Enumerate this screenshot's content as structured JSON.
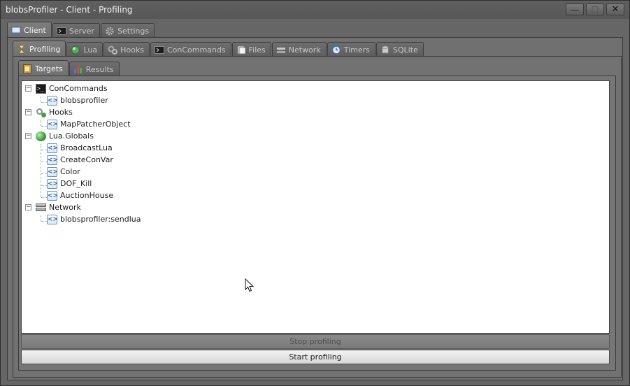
{
  "window": {
    "title": "blobsProfiler - Client - Profiling",
    "minimize_glyph": "—",
    "maximize_glyph": "☐",
    "close_glyph": "✕"
  },
  "main_tabs": [
    {
      "label": "Client",
      "icon": "monitor-icon",
      "active": true
    },
    {
      "label": "Server",
      "icon": "terminal-icon",
      "active": false
    },
    {
      "label": "Settings",
      "icon": "gear-icon",
      "active": false
    }
  ],
  "sub_tabs": [
    {
      "label": "Profiling",
      "icon": "hourglass-icon",
      "active": true
    },
    {
      "label": "Lua",
      "icon": "globe-icon",
      "active": false
    },
    {
      "label": "Hooks",
      "icon": "hook-icon",
      "active": false
    },
    {
      "label": "ConCommands",
      "icon": "terminal-icon",
      "active": false
    },
    {
      "label": "Files",
      "icon": "folder-icon",
      "active": false
    },
    {
      "label": "Network",
      "icon": "network-icon",
      "active": false
    },
    {
      "label": "Timers",
      "icon": "clock-icon",
      "active": false
    },
    {
      "label": "SQLite",
      "icon": "database-icon",
      "active": false
    }
  ],
  "profiling_tabs": [
    {
      "label": "Targets",
      "icon": "targets-icon",
      "active": true
    },
    {
      "label": "Results",
      "icon": "bar-chart-icon",
      "active": false
    }
  ],
  "tree": {
    "groups": [
      {
        "label": "ConCommands",
        "icon": "terminal-icon",
        "expander": "−",
        "children": [
          "blobsprofiler"
        ]
      },
      {
        "label": "Hooks",
        "icon": "hook-icon",
        "expander": "−",
        "children": [
          "MapPatcherObject"
        ]
      },
      {
        "label": "Lua.Globals",
        "icon": "globe-icon",
        "expander": "−",
        "children": [
          "BroadcastLua",
          "CreateConVar",
          "Color",
          "DOF_Kill",
          "AuctionHouse"
        ]
      },
      {
        "label": "Network",
        "icon": "network-icon",
        "expander": "−",
        "children": [
          "blobsprofiler:sendlua"
        ]
      }
    ],
    "child_icon": "function-icon",
    "child_glyph": "<>"
  },
  "buttons": {
    "stop": "Stop profiling",
    "start": "Start profiling"
  }
}
